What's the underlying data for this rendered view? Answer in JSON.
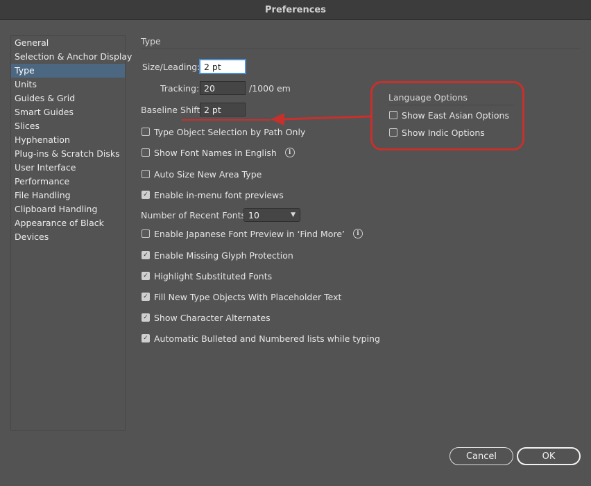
{
  "window": {
    "title": "Preferences"
  },
  "sidebar": {
    "items": [
      {
        "label": "General"
      },
      {
        "label": "Selection & Anchor Display"
      },
      {
        "label": "Type",
        "selected": true
      },
      {
        "label": "Units"
      },
      {
        "label": "Guides & Grid"
      },
      {
        "label": "Smart Guides"
      },
      {
        "label": "Slices"
      },
      {
        "label": "Hyphenation"
      },
      {
        "label": "Plug-ins & Scratch Disks"
      },
      {
        "label": "User Interface"
      },
      {
        "label": "Performance"
      },
      {
        "label": "File Handling"
      },
      {
        "label": "Clipboard Handling"
      },
      {
        "label": "Appearance of Black"
      },
      {
        "label": "Devices"
      }
    ]
  },
  "type_panel": {
    "section_title": "Type",
    "size_leading": {
      "label": "Size/Leading:",
      "value": "2 pt"
    },
    "tracking": {
      "label": "Tracking:",
      "value": "20",
      "unit": "/1000 em"
    },
    "baseline_shift": {
      "label": "Baseline Shift:",
      "value": "2 pt"
    },
    "options": {
      "type_object_selection": {
        "label": "Type Object Selection by Path Only",
        "checked": false
      },
      "show_font_names_english": {
        "label": "Show Font Names in English",
        "checked": false
      },
      "auto_size_area_type": {
        "label": "Auto Size New Area Type",
        "checked": false
      },
      "in_menu_font_previews": {
        "label": "Enable in-menu font previews",
        "checked": true
      },
      "japanese_font_preview": {
        "label": "Enable Japanese Font Preview in ‘Find More’",
        "checked": false
      },
      "missing_glyph_protection": {
        "label": "Enable Missing Glyph Protection",
        "checked": true
      },
      "highlight_substituted": {
        "label": "Highlight Substituted Fonts",
        "checked": true
      },
      "fill_placeholder": {
        "label": "Fill New Type Objects With Placeholder Text",
        "checked": true
      },
      "character_alternates": {
        "label": "Show Character Alternates",
        "checked": true
      },
      "auto_bullets": {
        "label": "Automatic Bulleted and Numbered lists while typing",
        "checked": true
      }
    },
    "recent_fonts": {
      "label": "Number of Recent Fonts:",
      "value": "10"
    }
  },
  "language_options": {
    "title": "Language Options",
    "east_asian": {
      "label": "Show East Asian Options",
      "checked": false
    },
    "indic": {
      "label": "Show Indic Options",
      "checked": false
    }
  },
  "buttons": {
    "cancel": "Cancel",
    "ok": "OK"
  },
  "colors": {
    "highlight_red": "#c8302c",
    "selection_blue": "#4b6781",
    "focus_blue": "#4a90d9"
  },
  "icons": {
    "info": "info-icon",
    "dropdown": "chevron-down-icon",
    "check": "checkmark-icon"
  }
}
